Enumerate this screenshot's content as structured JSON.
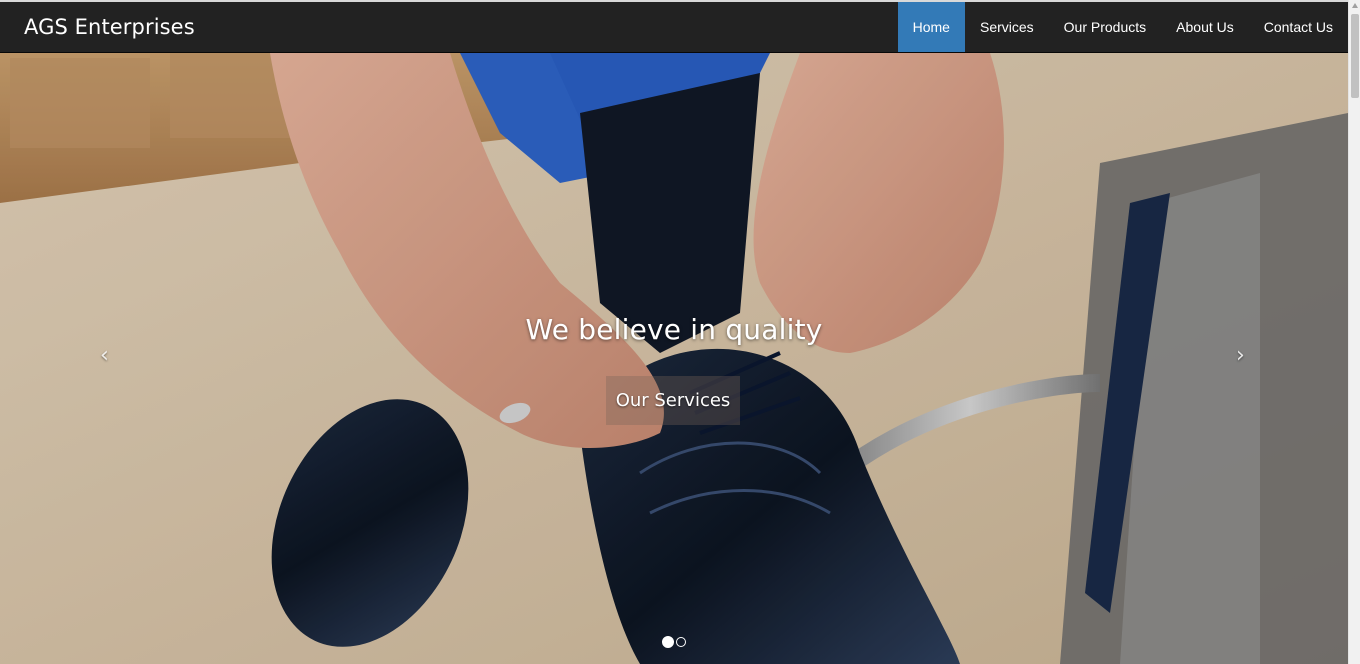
{
  "brand": "AGS Enterprises",
  "nav": {
    "items": [
      {
        "label": "Home",
        "active": true
      },
      {
        "label": "Services",
        "active": false
      },
      {
        "label": "Our Products",
        "active": false
      },
      {
        "label": "About Us",
        "active": false
      },
      {
        "label": "Contact Us",
        "active": false
      }
    ]
  },
  "hero": {
    "headline": "We believe in quality",
    "cta_label": "Our Services",
    "prev_arrow": "‹",
    "next_arrow": "›",
    "slide_count": 2,
    "active_slide": 1
  },
  "colors": {
    "navbar_bg": "#222222",
    "active_nav_bg": "#337ab7",
    "text": "#ffffff"
  }
}
